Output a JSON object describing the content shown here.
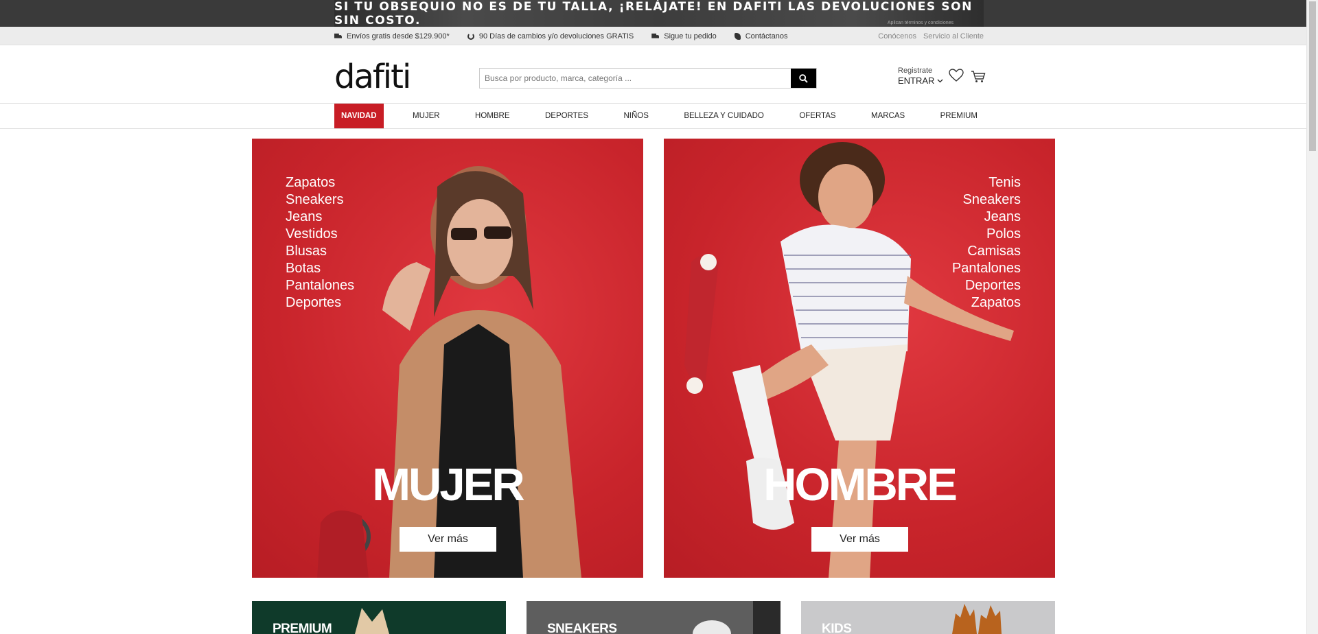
{
  "promo": {
    "text": "SI TU OBSEQUIO NO ES DE TU TALLA, ¡RELÁJATE! EN DAFITI LAS DEVOLUCIONES SON SIN COSTO.",
    "terms": "Aplican términos y condiciones"
  },
  "utility": {
    "items": [
      {
        "icon": "truck-icon",
        "label": "Envíos gratis desde $129.900*"
      },
      {
        "icon": "exchange-icon",
        "label": "90 Días de cambios y/o devoluciones GRATIS"
      },
      {
        "icon": "truck-icon",
        "label": "Sigue tu pedido"
      },
      {
        "icon": "phone-icon",
        "label": "Contáctanos"
      }
    ],
    "links": [
      "Conócenos",
      "Servicio al Cliente"
    ]
  },
  "header": {
    "logo": "dafiti",
    "search_placeholder": "Busca por producto, marca, categoría ...",
    "register": "Registrate",
    "login": "ENTRAR"
  },
  "nav": {
    "items": [
      "NAVIDAD",
      "MUJER",
      "HOMBRE",
      "DEPORTES",
      "NIÑOS",
      "BELLEZA Y CUIDADO",
      "OFERTAS",
      "MARCAS",
      "PREMIUM"
    ],
    "active": "NAVIDAD"
  },
  "heroes": {
    "mujer": {
      "title": "MUJER",
      "links": [
        "Zapatos",
        "Sneakers",
        "Jeans",
        "Vestidos",
        "Blusas",
        "Botas",
        "Pantalones",
        "Deportes"
      ],
      "button": "Ver más"
    },
    "hombre": {
      "title": "HOMBRE",
      "links": [
        "Tenis",
        "Sneakers",
        "Jeans",
        "Polos",
        "Camisas",
        "Pantalones",
        "Deportes",
        "Zapatos"
      ],
      "button": "Ver más"
    }
  },
  "tiles": [
    "PREMIUM",
    "SNEAKERS",
    "KIDS"
  ],
  "colors": {
    "accent": "#c81d25",
    "hero_red": "#d22b32"
  }
}
